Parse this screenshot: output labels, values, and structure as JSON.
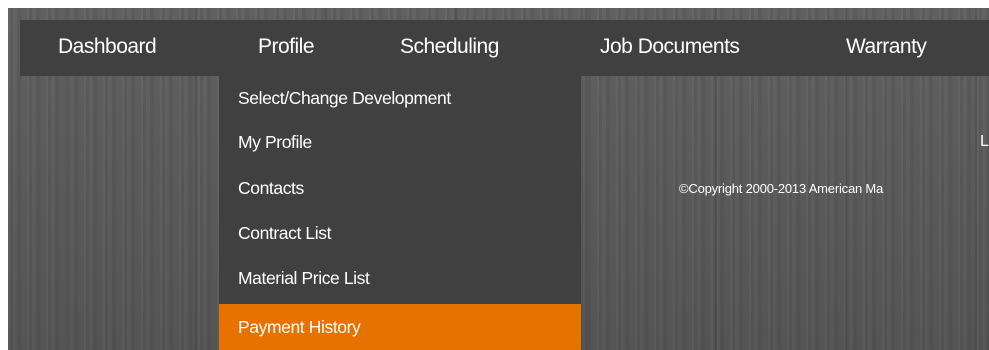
{
  "nav": {
    "items": [
      {
        "label": "Dashboard"
      },
      {
        "label": "Profile"
      },
      {
        "label": "Scheduling"
      },
      {
        "label": "Job Documents"
      },
      {
        "label": "Warranty"
      }
    ]
  },
  "profile_menu": {
    "items": [
      {
        "label": "Select/Change Development"
      },
      {
        "label": "My Profile"
      },
      {
        "label": "Contacts"
      },
      {
        "label": "Contract List"
      },
      {
        "label": "Material Price List"
      },
      {
        "label": "Payment History",
        "selected": true
      }
    ]
  },
  "content": {
    "partial_text": "L",
    "copyright": "©Copyright 2000-2013 American Ma"
  },
  "colors": {
    "nav_bg": "#404040",
    "highlight": "#e87200",
    "background": "#5a5a5a"
  }
}
